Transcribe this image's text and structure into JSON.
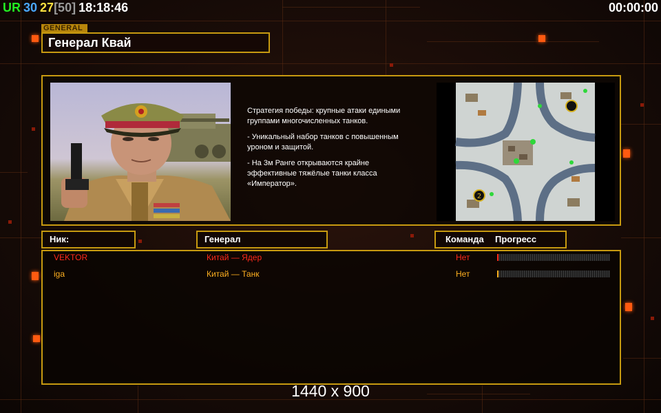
{
  "hud": {
    "ur": "UR",
    "n1": "30",
    "n2": "27",
    "n3": "[50]",
    "clock": "18:18:46",
    "timer": "00:00:00"
  },
  "general": {
    "tab_label": "GENERAL",
    "name": "Генерал Квай"
  },
  "description": [
    "Стратегия победы: крупные атаки едиными\n группами многочисленных танков.",
    "- Уникальный набор танков с повышенным\n уроном и защитой.",
    "- На 3м Ранге открываются крайне\n эффективные тяжёлые танки класса\n «Император»."
  ],
  "minimap": {
    "start_markers": [
      "2"
    ]
  },
  "table": {
    "headers": {
      "nick": "Ник:",
      "general": "Генерал",
      "team": "Команда",
      "progress": "Прогресс"
    },
    "rows": [
      {
        "nick": "VEKTOR",
        "general": "Китай — Ядер",
        "team": "Нет",
        "progress": 0.0,
        "color": "#ff2a1a"
      },
      {
        "nick": "iga",
        "general": "Китай — Танк",
        "team": "Нет",
        "progress": 0.0,
        "color": "#ffb020"
      }
    ]
  },
  "resolution_label": "1440 x 900",
  "colors": {
    "accent_border": "#c79a10",
    "hud_ur": "#22ee22",
    "hud_n1": "#4aa8ff",
    "hud_n2": "#ffe040",
    "hud_n3": "#aaaaaa"
  }
}
